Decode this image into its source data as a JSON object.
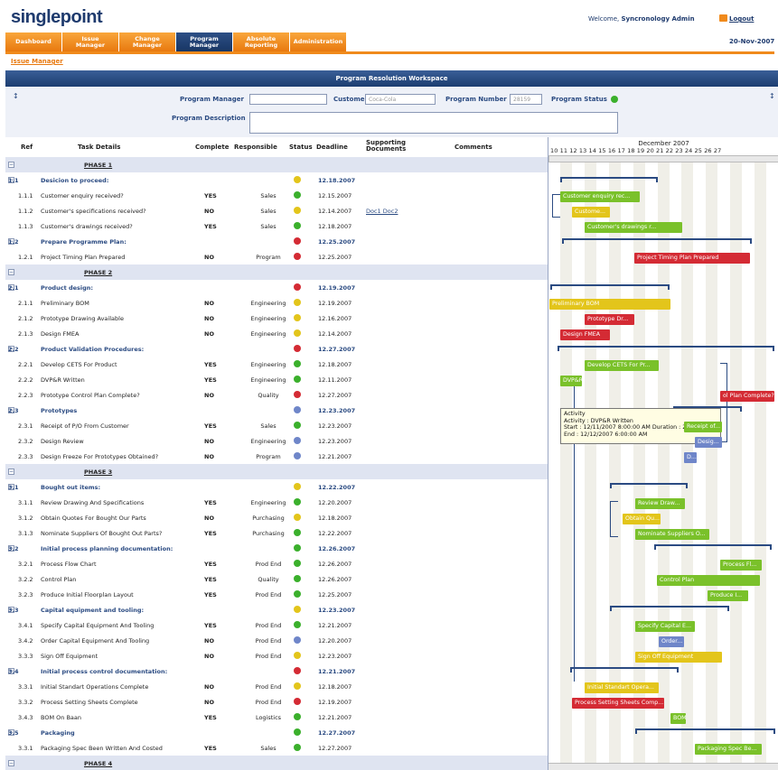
{
  "app": {
    "logo": "singlepoint",
    "welcome_prefix": "Welcome, ",
    "user": "Syncronology Admin",
    "logout": "Logout",
    "date": "20-Nov-2007"
  },
  "tabs": [
    "Dashboard",
    "Issue\nManager",
    "Change\nManager",
    "Program\nManager",
    "Absolute\nReporting",
    "Administration"
  ],
  "active_tab": "Program\nManager",
  "breadcrumb": "Issue Manager",
  "workspace_title": "Program Resolution Workspace",
  "form": {
    "program_manager_label": "Program Manager",
    "program_manager_value": "",
    "customer_label": "Customer",
    "customer_value": "Coca-Cola",
    "program_number_label": "Program Number",
    "program_number_value": "28159",
    "program_status_label": "Program Status",
    "program_description_label": "Program Description",
    "program_description_value": ""
  },
  "columns": {
    "ref": "Ref",
    "task": "Task Details",
    "complete": "Complete",
    "responsible": "Responsible",
    "status": "Status",
    "deadline": "Deadline",
    "docs": "Supporting\nDocuments",
    "comments": "Comments"
  },
  "status_colors": {
    "green": "#3bb02c",
    "yellow": "#e3c51b",
    "red": "#d42b34",
    "blue": "#6f86c9"
  },
  "rows": [
    {
      "type": "phase",
      "task": "PHASE 1"
    },
    {
      "type": "sec",
      "ref": "1.1",
      "task": "Desicion to proceed:",
      "status": "yellow",
      "deadline": "12.18.2007"
    },
    {
      "type": "task",
      "ref": "1.1.1",
      "task": "Customer enquiry received?",
      "complete": "YES",
      "resp": "Sales",
      "status": "green",
      "deadline": "12.15.2007"
    },
    {
      "type": "task",
      "ref": "1.1.2",
      "task": "Customer's specifications received?",
      "complete": "NO",
      "resp": "Sales",
      "status": "yellow",
      "deadline": "12.14.2007",
      "docs": "Doc1  Doc2"
    },
    {
      "type": "task",
      "ref": "1.1.3",
      "task": "Customer's drawings received?",
      "complete": "YES",
      "resp": "Sales",
      "status": "green",
      "deadline": "12.18.2007"
    },
    {
      "type": "sec",
      "ref": "1.2",
      "task": "Prepare Programme Plan:",
      "status": "red",
      "deadline": "12.25.2007"
    },
    {
      "type": "task",
      "ref": "1.2.1",
      "task": "Project Timing Plan Prepared",
      "complete": "NO",
      "resp": "Program",
      "status": "red",
      "deadline": "12.25.2007"
    },
    {
      "type": "phase",
      "task": "PHASE 2"
    },
    {
      "type": "sec",
      "ref": "2.1",
      "task": "Product design:",
      "status": "red",
      "deadline": "12.19.2007"
    },
    {
      "type": "task",
      "ref": "2.1.1",
      "task": "Preliminary BOM",
      "complete": "NO",
      "resp": "Engineering",
      "status": "yellow",
      "deadline": "12.19.2007"
    },
    {
      "type": "task",
      "ref": "2.1.2",
      "task": "Prototype Drawing Available",
      "complete": "NO",
      "resp": "Engineering",
      "status": "yellow",
      "deadline": "12.16.2007"
    },
    {
      "type": "task",
      "ref": "2.1.3",
      "task": "Design FMEA",
      "complete": "NO",
      "resp": "Engineering",
      "status": "yellow",
      "deadline": "12.14.2007"
    },
    {
      "type": "sec",
      "ref": "2.2",
      "task": "Product Validation Procedures:",
      "status": "red",
      "deadline": "12.27.2007"
    },
    {
      "type": "task",
      "ref": "2.2.1",
      "task": "Develop CETS For Product",
      "complete": "YES",
      "resp": "Engineering",
      "status": "green",
      "deadline": "12.18.2007"
    },
    {
      "type": "task",
      "ref": "2.2.2",
      "task": "DVP&R Written",
      "complete": "YES",
      "resp": "Engineering",
      "status": "green",
      "deadline": "12.11.2007"
    },
    {
      "type": "task",
      "ref": "2.2.3",
      "task": "Prototype Control Plan Complete?",
      "complete": "NO",
      "resp": "Quality",
      "status": "red",
      "deadline": "12.27.2007"
    },
    {
      "type": "sec",
      "ref": "2.3",
      "task": "Prototypes",
      "status": "blue",
      "deadline": "12.23.2007"
    },
    {
      "type": "task",
      "ref": "2.3.1",
      "task": "Receipt of P/O From Customer",
      "complete": "YES",
      "resp": "Sales",
      "status": "green",
      "deadline": "12.23.2007"
    },
    {
      "type": "task",
      "ref": "2.3.2",
      "task": "Design Review",
      "complete": "NO",
      "resp": "Engineering",
      "status": "blue",
      "deadline": "12.23.2007"
    },
    {
      "type": "task",
      "ref": "2.3.3",
      "task": "Design Freeze For Prototypes Obtained?",
      "complete": "NO",
      "resp": "Program",
      "status": "blue",
      "deadline": "12.21.2007"
    },
    {
      "type": "phase",
      "task": "PHASE 3"
    },
    {
      "type": "sec",
      "ref": "3.1",
      "task": "Bought out items:",
      "status": "yellow",
      "deadline": "12.22.2007"
    },
    {
      "type": "task",
      "ref": "3.1.1",
      "task": "Review Drawing And Specifications",
      "complete": "YES",
      "resp": "Engineering",
      "status": "green",
      "deadline": "12.20.2007"
    },
    {
      "type": "task",
      "ref": "3.1.2",
      "task": "Obtain Quotes For Bought Our Parts",
      "complete": "NO",
      "resp": "Purchasing",
      "status": "yellow",
      "deadline": "12.18.2007"
    },
    {
      "type": "task",
      "ref": "3.1.3",
      "task": "Nominate Suppliers Of Bought Out Parts?",
      "complete": "YES",
      "resp": "Purchasing",
      "status": "green",
      "deadline": "12.22.2007"
    },
    {
      "type": "sec",
      "ref": "3.2",
      "task": "Initial process planning documentation:",
      "status": "green",
      "deadline": "12.26.2007"
    },
    {
      "type": "task",
      "ref": "3.2.1",
      "task": "Process Flow Chart",
      "complete": "YES",
      "resp": "Prod End",
      "status": "green",
      "deadline": "12.26.2007"
    },
    {
      "type": "task",
      "ref": "3.2.2",
      "task": "Control Plan",
      "complete": "YES",
      "resp": "Quality",
      "status": "green",
      "deadline": "12.26.2007"
    },
    {
      "type": "task",
      "ref": "3.2.3",
      "task": "Produce Initial Floorplan Layout",
      "complete": "YES",
      "resp": "Prod End",
      "status": "green",
      "deadline": "12.25.2007"
    },
    {
      "type": "sec",
      "ref": "3.3",
      "task": "Capital equipment and tooling:",
      "status": "yellow",
      "deadline": "12.23.2007"
    },
    {
      "type": "task",
      "ref": "3.4.1",
      "task": "Specify Capital Equipment And Tooling",
      "complete": "YES",
      "resp": "Prod End",
      "status": "green",
      "deadline": "12.21.2007"
    },
    {
      "type": "task",
      "ref": "3.4.2",
      "task": "Order Capital Equipment And Tooling",
      "complete": "NO",
      "resp": "Prod End",
      "status": "blue",
      "deadline": "12.20.2007"
    },
    {
      "type": "task",
      "ref": "3.3.3",
      "task": "Sign Off Equipment",
      "complete": "NO",
      "resp": "Prod End",
      "status": "yellow",
      "deadline": "12.23.2007"
    },
    {
      "type": "sec",
      "ref": "3.4",
      "task": "Initial process control documentation:",
      "status": "red",
      "deadline": "12.21.2007"
    },
    {
      "type": "task",
      "ref": "3.3.1",
      "task": "Initial Standart Operations Complete",
      "complete": "NO",
      "resp": "Prod End",
      "status": "yellow",
      "deadline": "12.18.2007"
    },
    {
      "type": "task",
      "ref": "3.3.2",
      "task": "Process Setting Sheets Complete",
      "complete": "NO",
      "resp": "Prod End",
      "status": "red",
      "deadline": "12.19.2007"
    },
    {
      "type": "task",
      "ref": "3.4.3",
      "task": "BOM On Baan",
      "complete": "YES",
      "resp": "Logistics",
      "status": "green",
      "deadline": "12.21.2007"
    },
    {
      "type": "sec",
      "ref": "3.5",
      "task": "Packaging",
      "status": "green",
      "deadline": "12.27.2007"
    },
    {
      "type": "task",
      "ref": "3.3.1",
      "task": "Packaging Spec Been Written And Costed",
      "complete": "YES",
      "resp": "Sales",
      "status": "green",
      "deadline": "12.27.2007"
    },
    {
      "type": "phase",
      "task": "PHASE 4"
    }
  ],
  "gantt": {
    "month": "December 2007",
    "days": "10 11 12 13 14 15 16 17 18 19 20 21 22 23 24 25 26 27",
    "bar_colors": {
      "green": "#7ac12a",
      "red": "#d42b34",
      "yellow": "#e3c51b",
      "blue": "#6f86c9"
    },
    "bars": [
      {
        "label": "Customer enquiry rec...",
        "color": "green",
        "row": 2
      },
      {
        "label": "Custome...",
        "color": "yellow",
        "row": 3
      },
      {
        "label": "Customer's drawings r...",
        "color": "green",
        "row": 4
      },
      {
        "label": "Project Timing Plan Prepared",
        "color": "red",
        "row": 6
      },
      {
        "label": "Preliminary BOM",
        "color": "yellow",
        "row": 9
      },
      {
        "label": "Prototype Dr...",
        "color": "red",
        "row": 10
      },
      {
        "label": "Design FMEA",
        "color": "red",
        "row": 11
      },
      {
        "label": "Develop CETS For Pr...",
        "color": "green",
        "row": 13
      },
      {
        "label": "DVP&R",
        "color": "green",
        "row": 14
      },
      {
        "label": "ol Plan Complete?",
        "color": "red",
        "row": 15
      },
      {
        "label": "Receipt of...",
        "color": "green",
        "row": 17
      },
      {
        "label": "Desig...",
        "color": "blue",
        "row": 18
      },
      {
        "label": "D...",
        "color": "blue",
        "row": 19
      },
      {
        "label": "Review Draw...",
        "color": "green",
        "row": 22
      },
      {
        "label": "Obtain Qu...",
        "color": "yellow",
        "row": 23
      },
      {
        "label": "Nominate Suppliers O...",
        "color": "green",
        "row": 24
      },
      {
        "label": "Process Fl...",
        "color": "green",
        "row": 26
      },
      {
        "label": "Control Plan",
        "color": "green",
        "row": 27
      },
      {
        "label": "Produce I...",
        "color": "green",
        "row": 28
      },
      {
        "label": "Specify Capital E...",
        "color": "green",
        "row": 30
      },
      {
        "label": "Order...",
        "color": "blue",
        "row": 31
      },
      {
        "label": "Sign Off Equipment",
        "color": "yellow",
        "row": 32
      },
      {
        "label": "Initial Standart Opera...",
        "color": "yellow",
        "row": 34
      },
      {
        "label": "Process Setting Sheets Comp...",
        "color": "red",
        "row": 35
      },
      {
        "label": "BOM...",
        "color": "green",
        "row": 36
      },
      {
        "label": "Packaging Spec Be...",
        "color": "green",
        "row": 38
      }
    ],
    "tooltip": {
      "title": "Activity",
      "line1": "Activity : DVP&R Written",
      "line2": "Start : 12/11/2007 8:00:00 AM   Duration : 22 hours",
      "line3": "End : 12/12/2007 6:00:00 AM"
    }
  }
}
